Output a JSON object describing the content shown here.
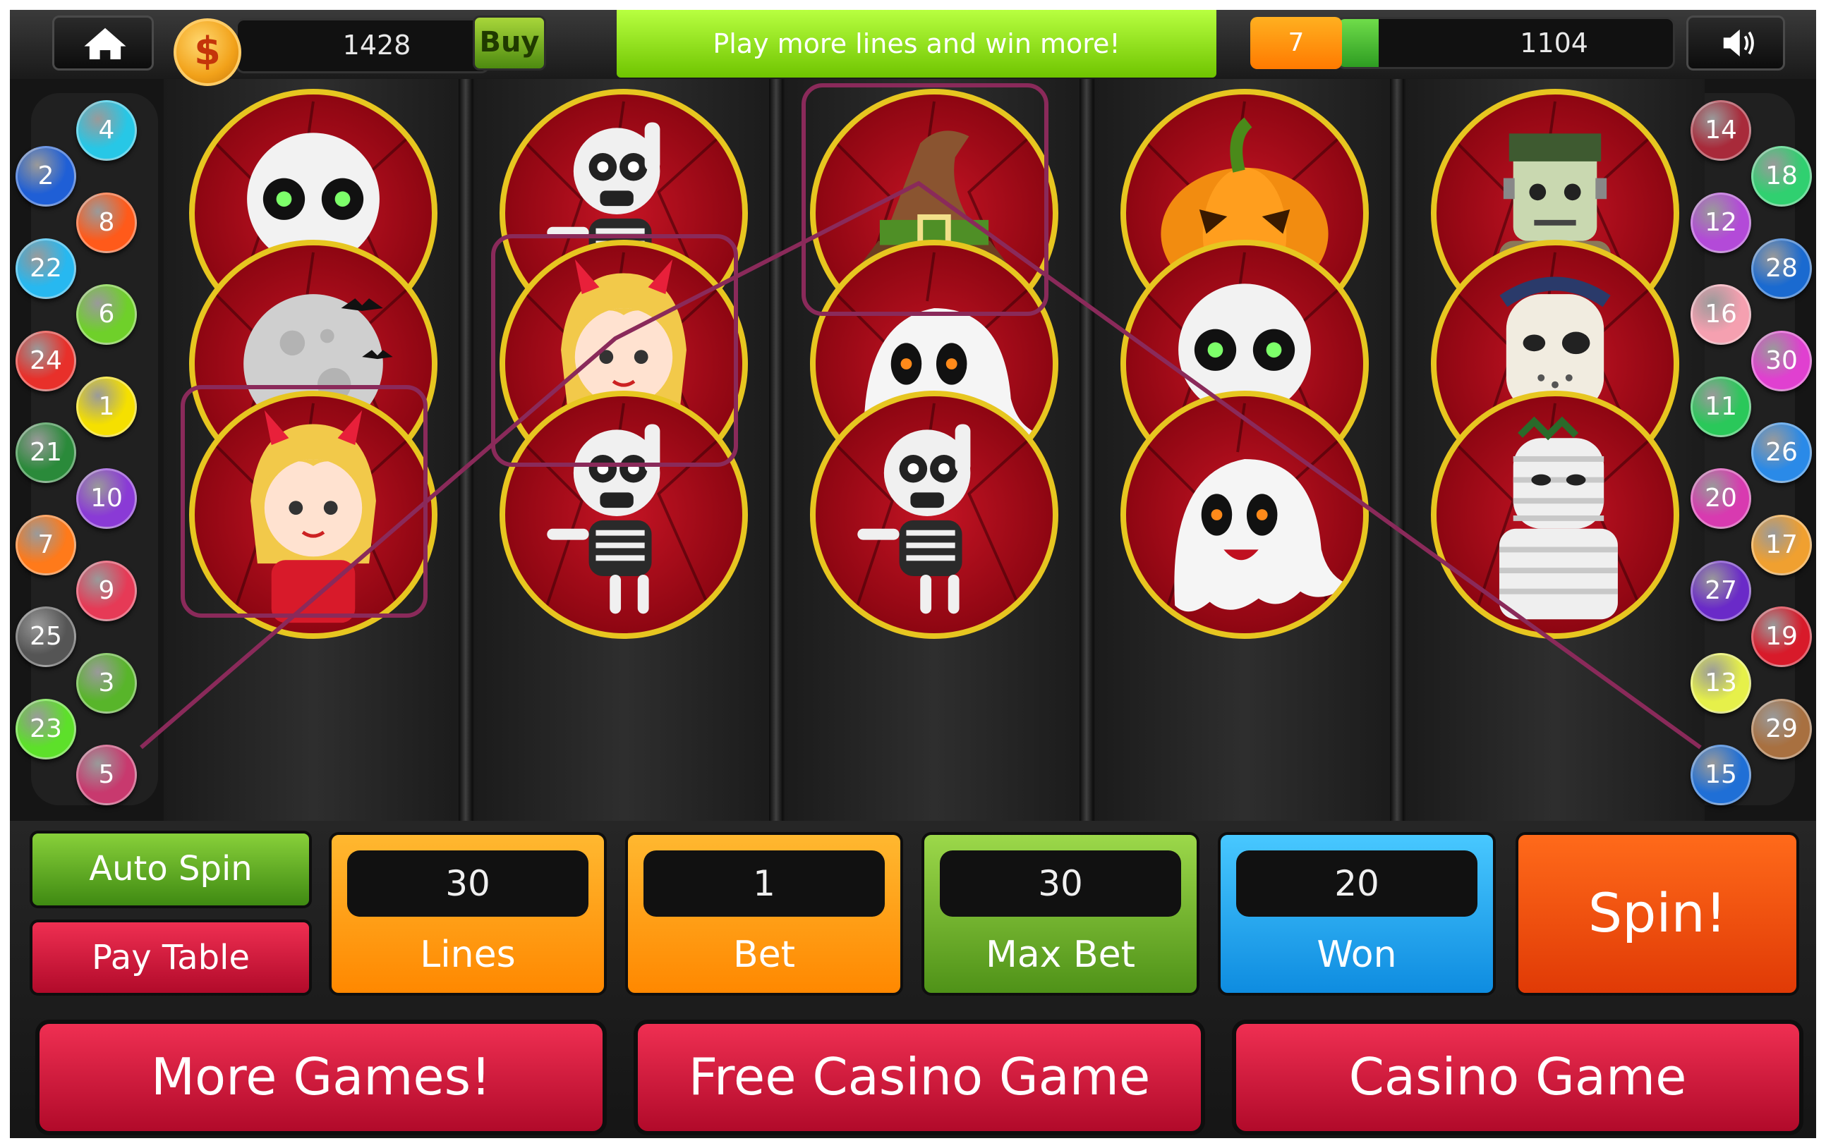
{
  "topbar": {
    "home_icon": "home-icon",
    "coin_icon": "dollar-coin-icon",
    "coin_symbol": "$",
    "credits": "1428",
    "buy_label": "Buy",
    "banner_text": "Play more lines and win more!",
    "level": "7",
    "xp_value": "1104",
    "xp_progress": 0.12,
    "sound_icon": "speaker-icon"
  },
  "reels": [
    [
      "skull",
      "skeleton",
      "witch-hat",
      "pumpkin",
      "frankenstein"
    ],
    [
      "moon",
      "devil-girl",
      "ghost",
      "skull",
      "hockey-mask-killer"
    ],
    [
      "devil-girl",
      "skeleton",
      "skeleton",
      "ghost",
      "mummy"
    ]
  ],
  "paylines": {
    "left": [
      "4",
      "2",
      "8",
      "22",
      "6",
      "24",
      "1",
      "21",
      "10",
      "7",
      "9",
      "25",
      "3",
      "23",
      "5"
    ],
    "right": [
      "14",
      "18",
      "12",
      "28",
      "16",
      "30",
      "11",
      "26",
      "20",
      "17",
      "27",
      "19",
      "13",
      "29",
      "15"
    ],
    "colors": {
      "1": "#f5e000",
      "2": "#1f5fd6",
      "3": "#58b52a",
      "4": "#27c7e6",
      "5": "#c8396e",
      "6": "#6fd02a",
      "7": "#ff7a1a",
      "8": "#ff5a1a",
      "9": "#e63a56",
      "10": "#8a3ad6",
      "11": "#2ac85a",
      "12": "#b34ad8",
      "13": "#e6f04a",
      "14": "#a82a3a",
      "15": "#1f6fd6",
      "16": "#f5a0b0",
      "17": "#f0a030",
      "18": "#30d070",
      "19": "#d81a2a",
      "20": "#d83ab0",
      "21": "#2a8a3a",
      "22": "#27b8f0",
      "23": "#5de02a",
      "24": "#e8302a",
      "25": "#555555",
      "26": "#2a8ae8",
      "27": "#6a2ac8",
      "28": "#1a6ad0",
      "29": "#a87040",
      "30": "#e040d0"
    }
  },
  "controls": {
    "auto_spin": "Auto Spin",
    "pay_table": "Pay Table",
    "lines_value": "30",
    "lines_label": "Lines",
    "bet_value": "1",
    "bet_label": "Bet",
    "maxbet_value": "30",
    "maxbet_label": "Max Bet",
    "won_value": "20",
    "won_label": "Won",
    "spin_label": "Spin!",
    "more_games": "More Games!",
    "free_casino": "Free Casino Game",
    "casino_game": "Casino Game"
  },
  "colors": {
    "gold_ring": "#e7c620",
    "symbol_bg": "#c41424",
    "banner_green": "#8ad400",
    "lines_orange": "#ff9a10",
    "maxbet_green": "#6aa81e",
    "won_blue": "#1ea6f0",
    "spin_orange": "#f24e0a",
    "big_button_red": "#d8163a",
    "winline": "#8a2a5a"
  }
}
